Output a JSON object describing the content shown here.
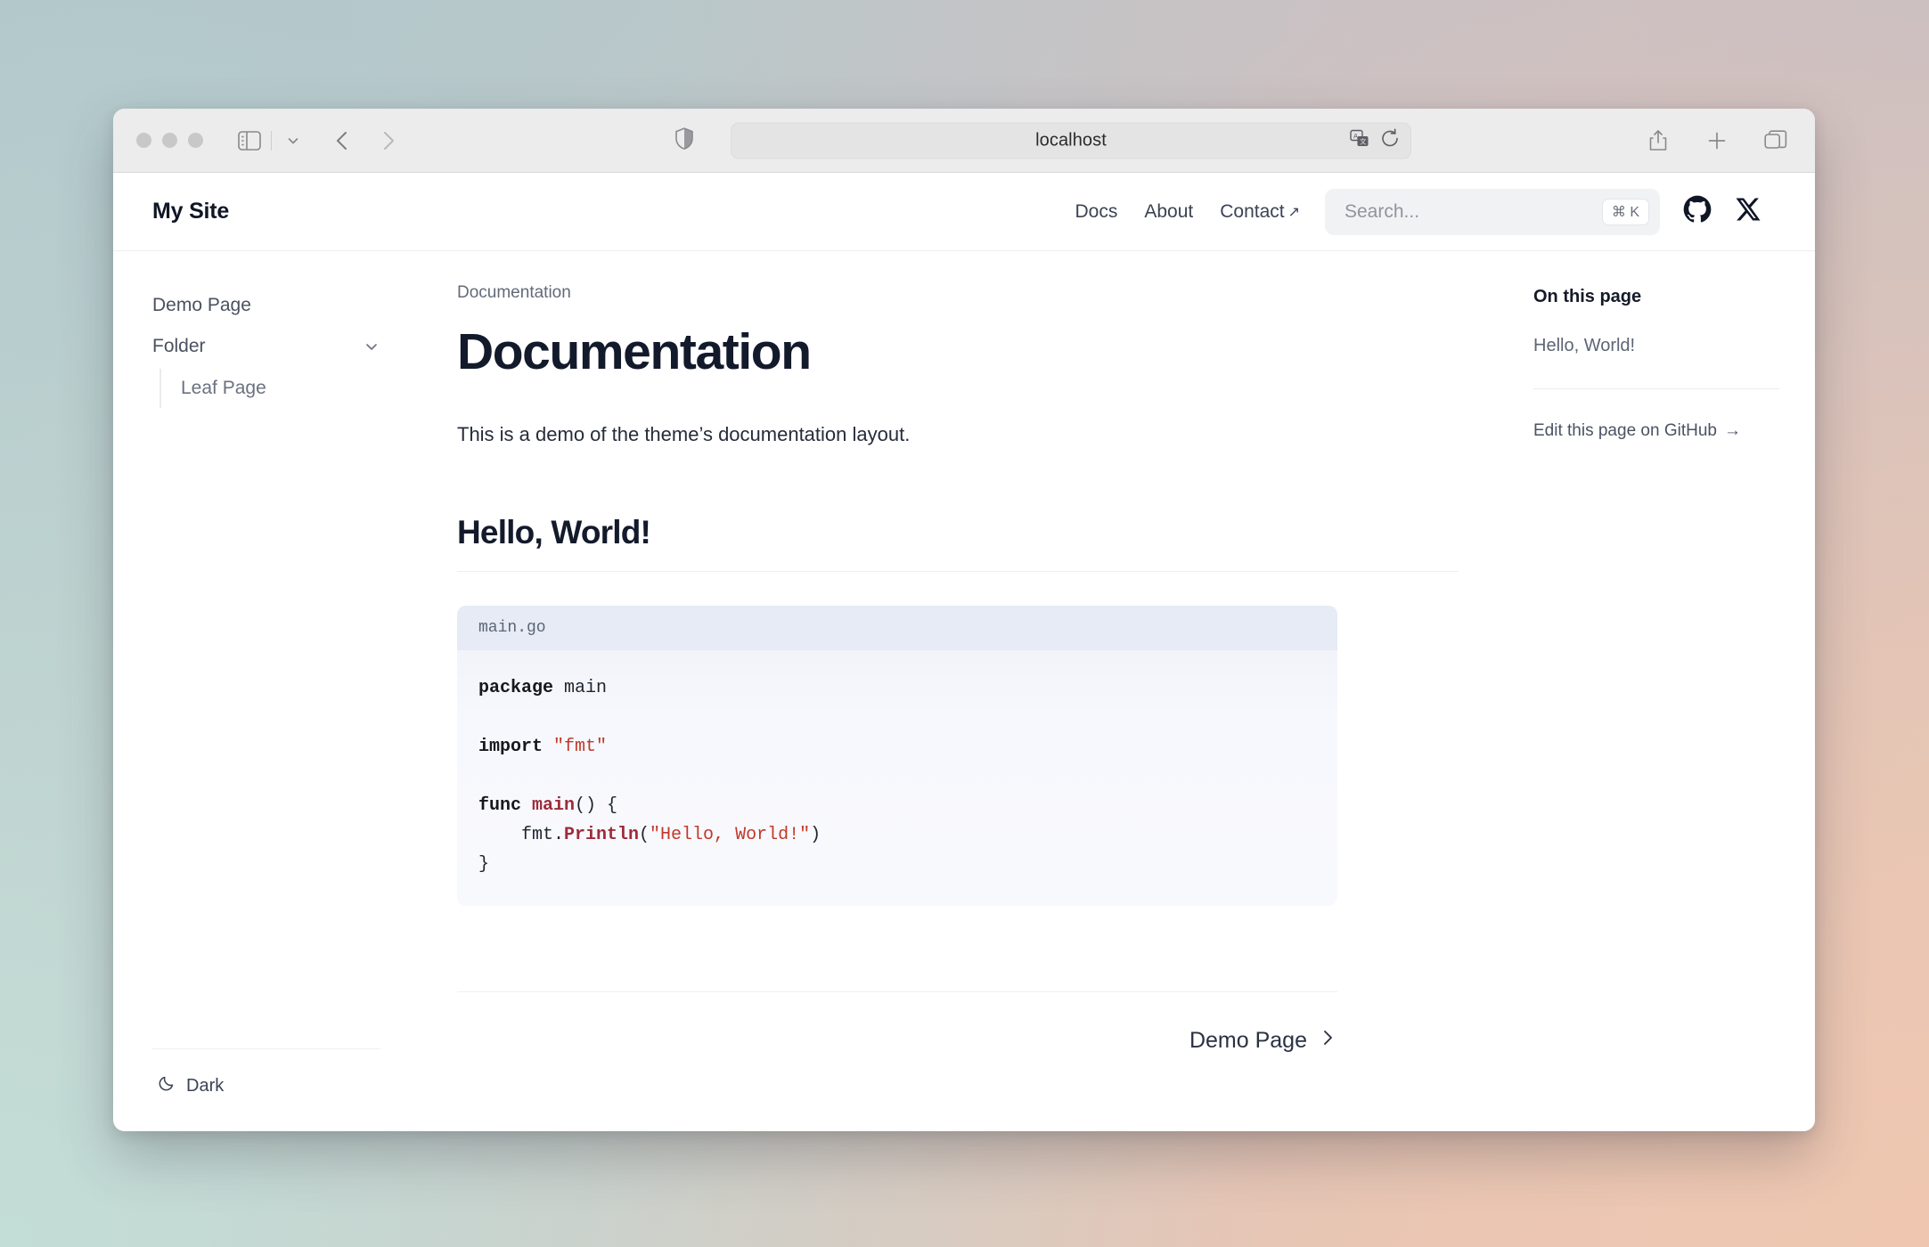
{
  "browser": {
    "url": "localhost",
    "icons": {
      "sidebar": "sidebar-icon",
      "chevron_down": "chevron-down-icon",
      "back": "back-arrow-icon",
      "forward": "forward-arrow-icon",
      "shield": "shield-icon",
      "translate": "translate-icon",
      "reload": "reload-icon",
      "share": "share-icon",
      "new_tab": "plus-icon",
      "tab_overview": "tab-overview-icon"
    }
  },
  "site": {
    "brand": "My Site",
    "nav": [
      {
        "label": "Docs",
        "external": false
      },
      {
        "label": "About",
        "external": false
      },
      {
        "label": "Contact",
        "external": true,
        "external_glyph": "↗"
      }
    ],
    "search": {
      "placeholder": "Search...",
      "shortcut": "⌘ K"
    },
    "social": [
      {
        "name": "github-icon"
      },
      {
        "name": "x-twitter-icon"
      }
    ]
  },
  "sidebar": {
    "items": [
      {
        "label": "Demo Page",
        "has_children": false
      },
      {
        "label": "Folder",
        "has_children": true,
        "chevron": "chevron-down-icon"
      }
    ],
    "children": [
      {
        "label": "Leaf Page"
      }
    ],
    "theme_toggle": {
      "label": "Dark",
      "icon": "moon-icon"
    }
  },
  "main": {
    "breadcrumb": "Documentation",
    "title": "Documentation",
    "lede": "This is a demo of the theme’s documentation layout.",
    "section_heading": "Hello, World!",
    "code": {
      "filename": "main.go",
      "lines": [
        {
          "tokens": [
            {
              "t": "package",
              "c": "kw"
            },
            {
              "t": " main",
              "c": "plain"
            }
          ]
        },
        {
          "tokens": []
        },
        {
          "tokens": [
            {
              "t": "import",
              "c": "kw"
            },
            {
              "t": " ",
              "c": "plain"
            },
            {
              "t": "\"fmt\"",
              "c": "str"
            }
          ]
        },
        {
          "tokens": []
        },
        {
          "tokens": [
            {
              "t": "func",
              "c": "kw"
            },
            {
              "t": " ",
              "c": "plain"
            },
            {
              "t": "main",
              "c": "fn"
            },
            {
              "t": "() {",
              "c": "plain"
            }
          ]
        },
        {
          "tokens": [
            {
              "t": "    fmt.",
              "c": "plain"
            },
            {
              "t": "Println",
              "c": "fn"
            },
            {
              "t": "(",
              "c": "plain"
            },
            {
              "t": "\"Hello, World!\"",
              "c": "str"
            },
            {
              "t": ")",
              "c": "plain"
            }
          ]
        },
        {
          "tokens": [
            {
              "t": "}",
              "c": "plain"
            }
          ]
        }
      ]
    },
    "pager": {
      "label": "Demo Page",
      "glyph": "›"
    }
  },
  "toc": {
    "title": "On this page",
    "links": [
      {
        "label": "Hello, World!"
      }
    ],
    "edit": {
      "label": "Edit this page on GitHub",
      "glyph": "→"
    }
  }
}
